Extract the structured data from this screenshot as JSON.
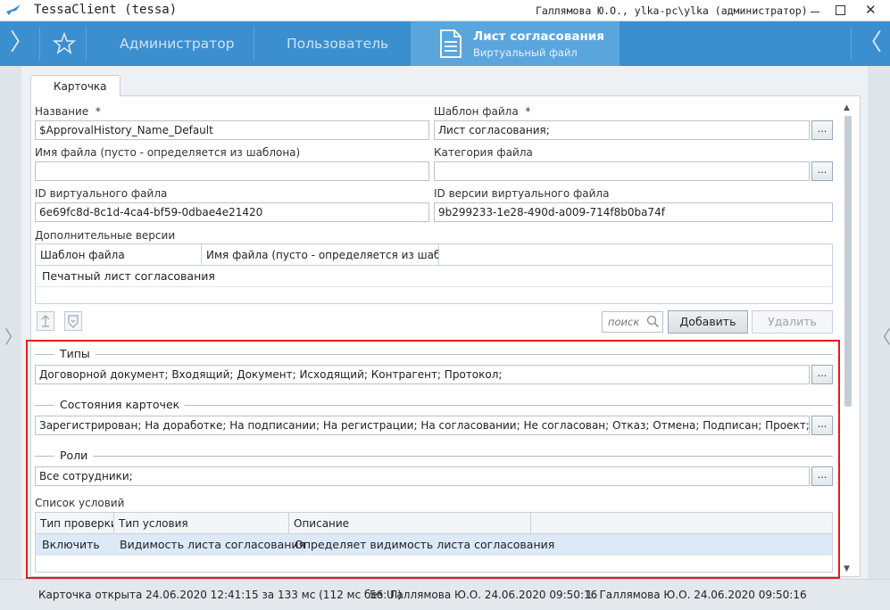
{
  "window": {
    "app_title": "TessaClient (tessa)",
    "user_info": "Галлямова Ю.О., ylka-pc\\ylka (администратор)",
    "close_glyph": "✕"
  },
  "nav": {
    "left_arrow": "〉",
    "right_arrow": "〈",
    "tabs": [
      "Администратор",
      "Пользователь"
    ],
    "active_title": "Лист согласования",
    "active_subtitle": "Виртуальный файл"
  },
  "card": {
    "tab_label": "Карточка",
    "name_label": "Название",
    "name_value": "$ApprovalHistory_Name_Default",
    "template_label": "Шаблон файла",
    "template_value": "Лист согласования;",
    "required_mark": "*",
    "filename_label": "Имя файла (пусто - определяется из шаблона)",
    "filename_value": "",
    "category_label": "Категория файла",
    "category_value": "",
    "vfile_id_label": "ID виртуального файла",
    "vfile_id_value": "6e69fc8d-8c1d-4ca4-bf59-0dbae4e21420",
    "version_id_label": "ID версии виртуального файла",
    "version_id_value": "9b299233-1e28-490d-a009-714f8b0ba74f",
    "dots": "...",
    "extra_versions": {
      "label": "Дополнительные версии",
      "columns": [
        "Шаблон файла",
        "Имя файла (пусто - определяется из шаблона)"
      ],
      "rows": [
        [
          "Печатный лист согласования",
          ""
        ]
      ]
    },
    "search_placeholder": "поиск",
    "add_button": "Добавить",
    "delete_button": "Удалить",
    "types": {
      "title": "Типы",
      "value": "Договорной документ; Входящий; Документ; Исходящий; Контрагент; Протокол;"
    },
    "states": {
      "title": "Состояния карточек",
      "value": "Зарегистрирован; На доработке; На подписании; На регистрации; На согласовании; Не согласован; Отказ; Отмена; Подписан; Проект; Согласован;"
    },
    "roles": {
      "title": "Роли",
      "value": "Все сотрудники;"
    },
    "conditions": {
      "label": "Список условий",
      "columns": [
        "Тип проверки",
        "Тип условия",
        "Описание"
      ],
      "rows": [
        [
          "Включить",
          "Видимость листа согласования",
          "Определяет видимость листа согласования"
        ]
      ]
    }
  },
  "status": {
    "opened": "Карточка открыта 24.06.2020 12:41:15 за 133 мс (112 мс без UI)",
    "version_modified": "56:  Галлямова Ю.О.  24.06.2020 09:50:16",
    "version_created": "1:  Галлямова Ю.О.  24.06.2020 09:50:16"
  },
  "colors": {
    "nav_bg": "#3b8fcf",
    "nav_active_bg": "#5aa5dc",
    "highlight_border": "#e51b1b",
    "selected_row_bg": "#dce9f7"
  }
}
